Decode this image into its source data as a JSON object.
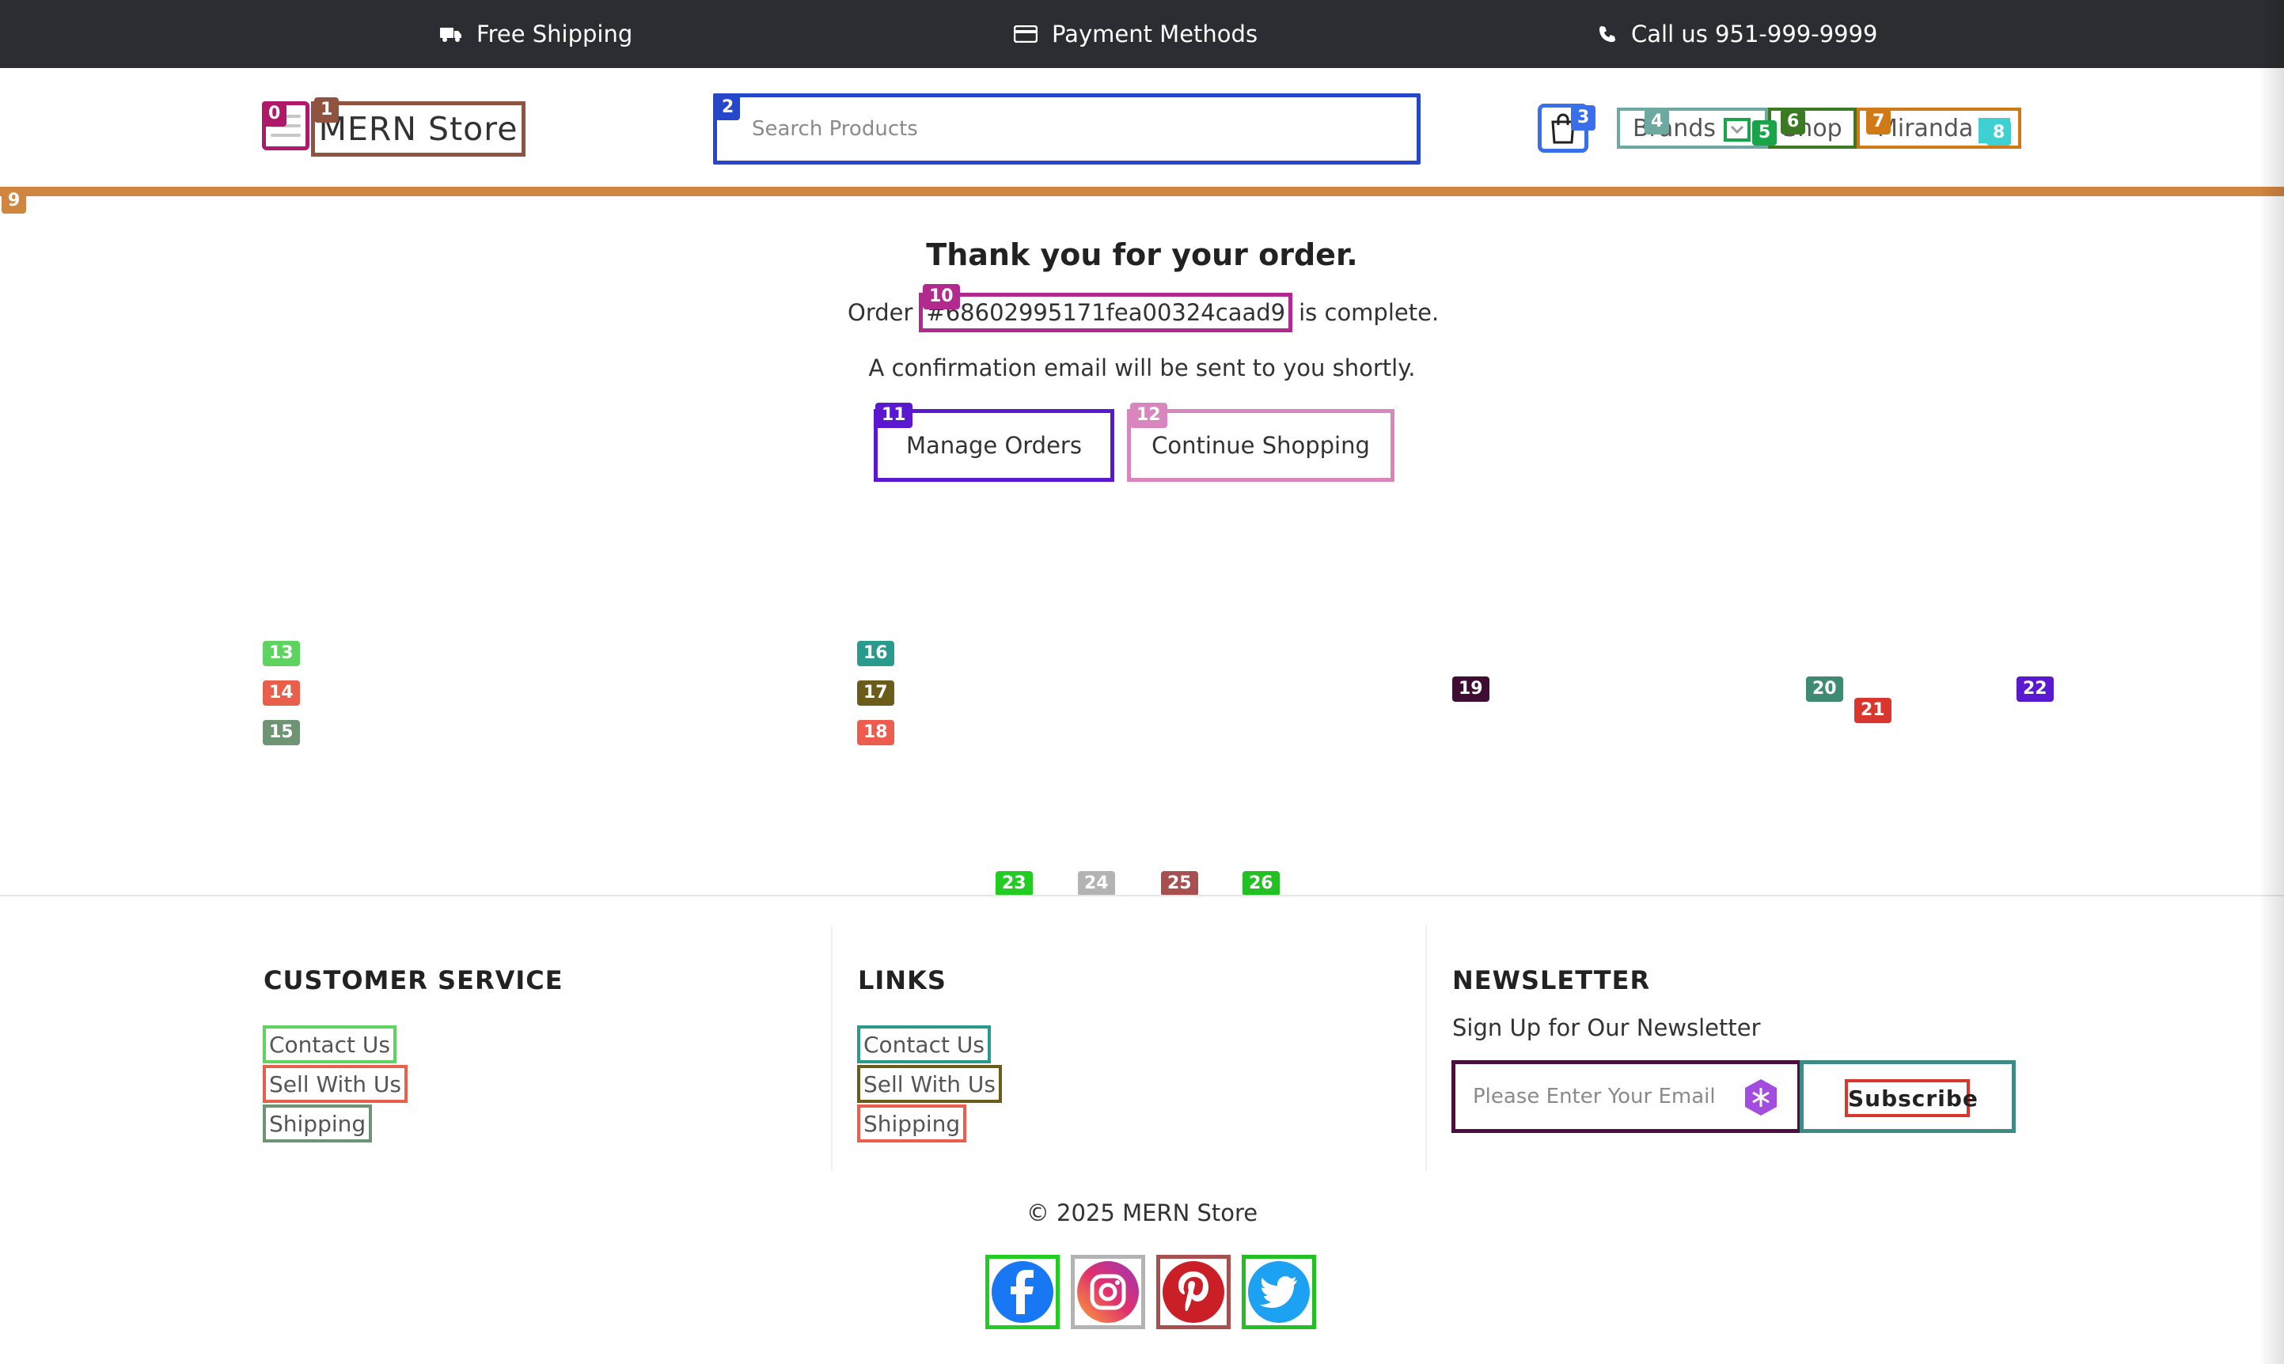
{
  "topbar": {
    "shipping": "Free Shipping",
    "payment": "Payment Methods",
    "call": "Call us 951-999-9999"
  },
  "header": {
    "logo": "MERN Store",
    "search_placeholder": "Search Products",
    "nav_brands": "Brands",
    "nav_shop": "Shop",
    "nav_user": "Miranda"
  },
  "order": {
    "title": "Thank you for your order.",
    "prefix": "Order",
    "id": "#68602995171fea00324caad9",
    "suffix": "is complete.",
    "confirm": "A confirmation email will be sent to you shortly.",
    "manage_label": "Manage Orders",
    "continue_label": "Continue Shopping"
  },
  "markers": [
    "0",
    "1",
    "2",
    "3",
    "4",
    "5",
    "6",
    "7",
    "8",
    "9",
    "10",
    "11",
    "12",
    "13",
    "14",
    "15",
    "16",
    "17",
    "18",
    "19",
    "20",
    "21",
    "22",
    "23",
    "24",
    "25",
    "26"
  ],
  "footer": {
    "customer_service": {
      "title": "CUSTOMER SERVICE",
      "links": [
        "Contact Us",
        "Sell With Us",
        "Shipping"
      ]
    },
    "links": {
      "title": "LINKS",
      "links": [
        "Contact Us",
        "Sell With Us",
        "Shipping"
      ]
    },
    "newsletter": {
      "title": "NEWSLETTER",
      "subtitle": "Sign Up for Our Newsletter",
      "placeholder": "Please Enter Your Email",
      "button": "Subscribe"
    },
    "copyright": "© 2025 MERN Store",
    "social": [
      "facebook-icon",
      "instagram-icon",
      "pinterest-icon",
      "twitter-icon"
    ]
  },
  "colors": {
    "topbar_bg": "#2a2d31",
    "accent_line": "#cf8641",
    "facebook": "#1877f2",
    "pinterest": "#cb1f27",
    "twitter": "#1da1f2"
  }
}
